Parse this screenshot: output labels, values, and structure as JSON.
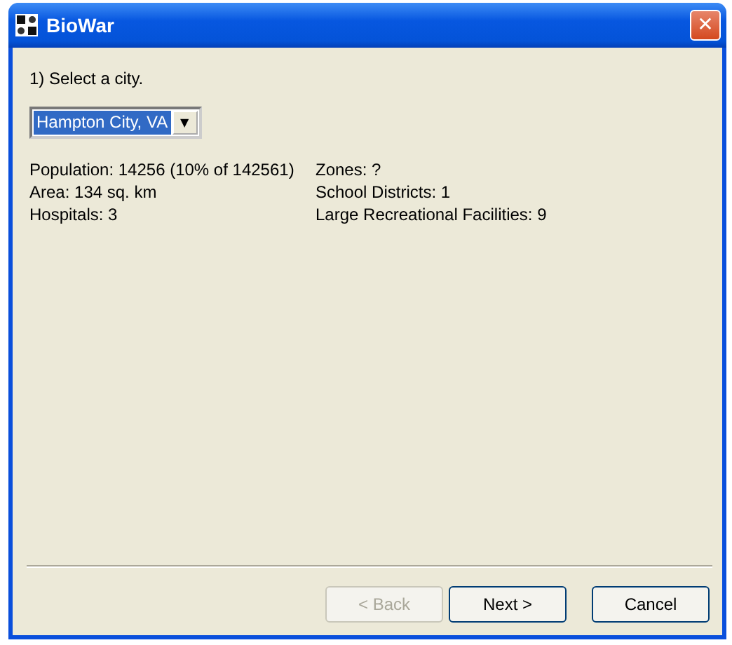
{
  "window": {
    "title": "BioWar",
    "close_label": "✕"
  },
  "step": "1) Select a city.",
  "city_select": {
    "value": "Hampton City, VA",
    "arrow": "▼"
  },
  "info_left": [
    "Population: 14256 (10% of 142561)",
    "Area: 134 sq. km",
    "Hospitals: 3"
  ],
  "info_right": [
    "Zones: ?",
    "School Districts: 1",
    "Large Recreational Facilities: 9"
  ],
  "buttons": [
    {
      "label": "< Back",
      "disabled": true
    },
    {
      "label": "Next >",
      "disabled": false
    },
    {
      "label": "Cancel",
      "disabled": false
    }
  ]
}
